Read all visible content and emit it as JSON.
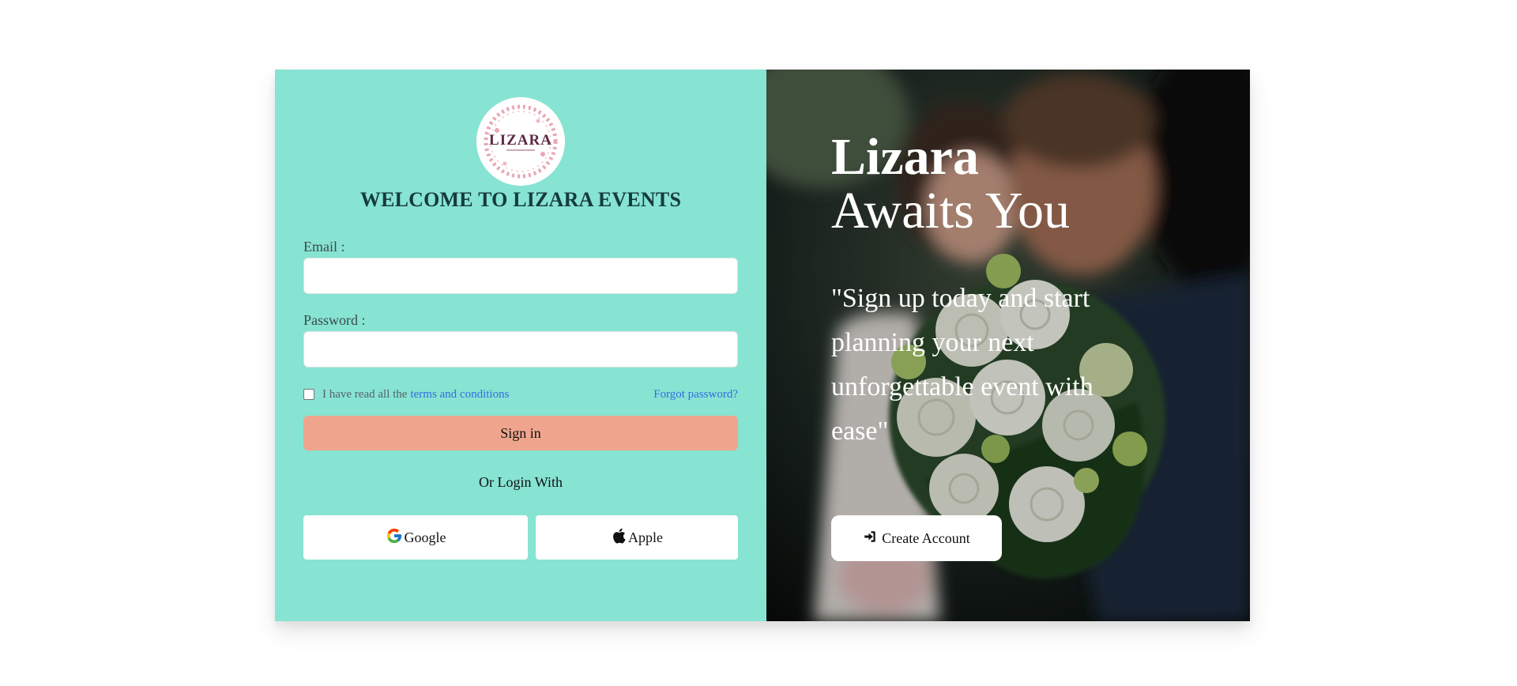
{
  "login": {
    "logo_text": "LIZARA",
    "welcome": "WELCOME TO LIZARA EVENTS",
    "email_label": "Email :",
    "email_value": "",
    "password_label": "Password :",
    "password_value": "",
    "terms_prefix": "I have read all the ",
    "terms_link": "terms and conditions",
    "forgot": "Forgot password?",
    "signin": "Sign in",
    "or_login": "Or Login With",
    "google": "Google",
    "apple": "Apple"
  },
  "hero": {
    "title_line1": "Lizara",
    "title_line2": "Awaits You",
    "quote": "\"Sign up today and start planning your next unforgettable event with ease\"",
    "create_account": "Create Account"
  },
  "colors": {
    "left_panel": "#87e3d2",
    "signin_button": "#efa58d",
    "link": "#2f6fe4"
  },
  "icons": {
    "google": "google-icon",
    "apple": "apple-icon",
    "create": "sign-in-icon"
  }
}
